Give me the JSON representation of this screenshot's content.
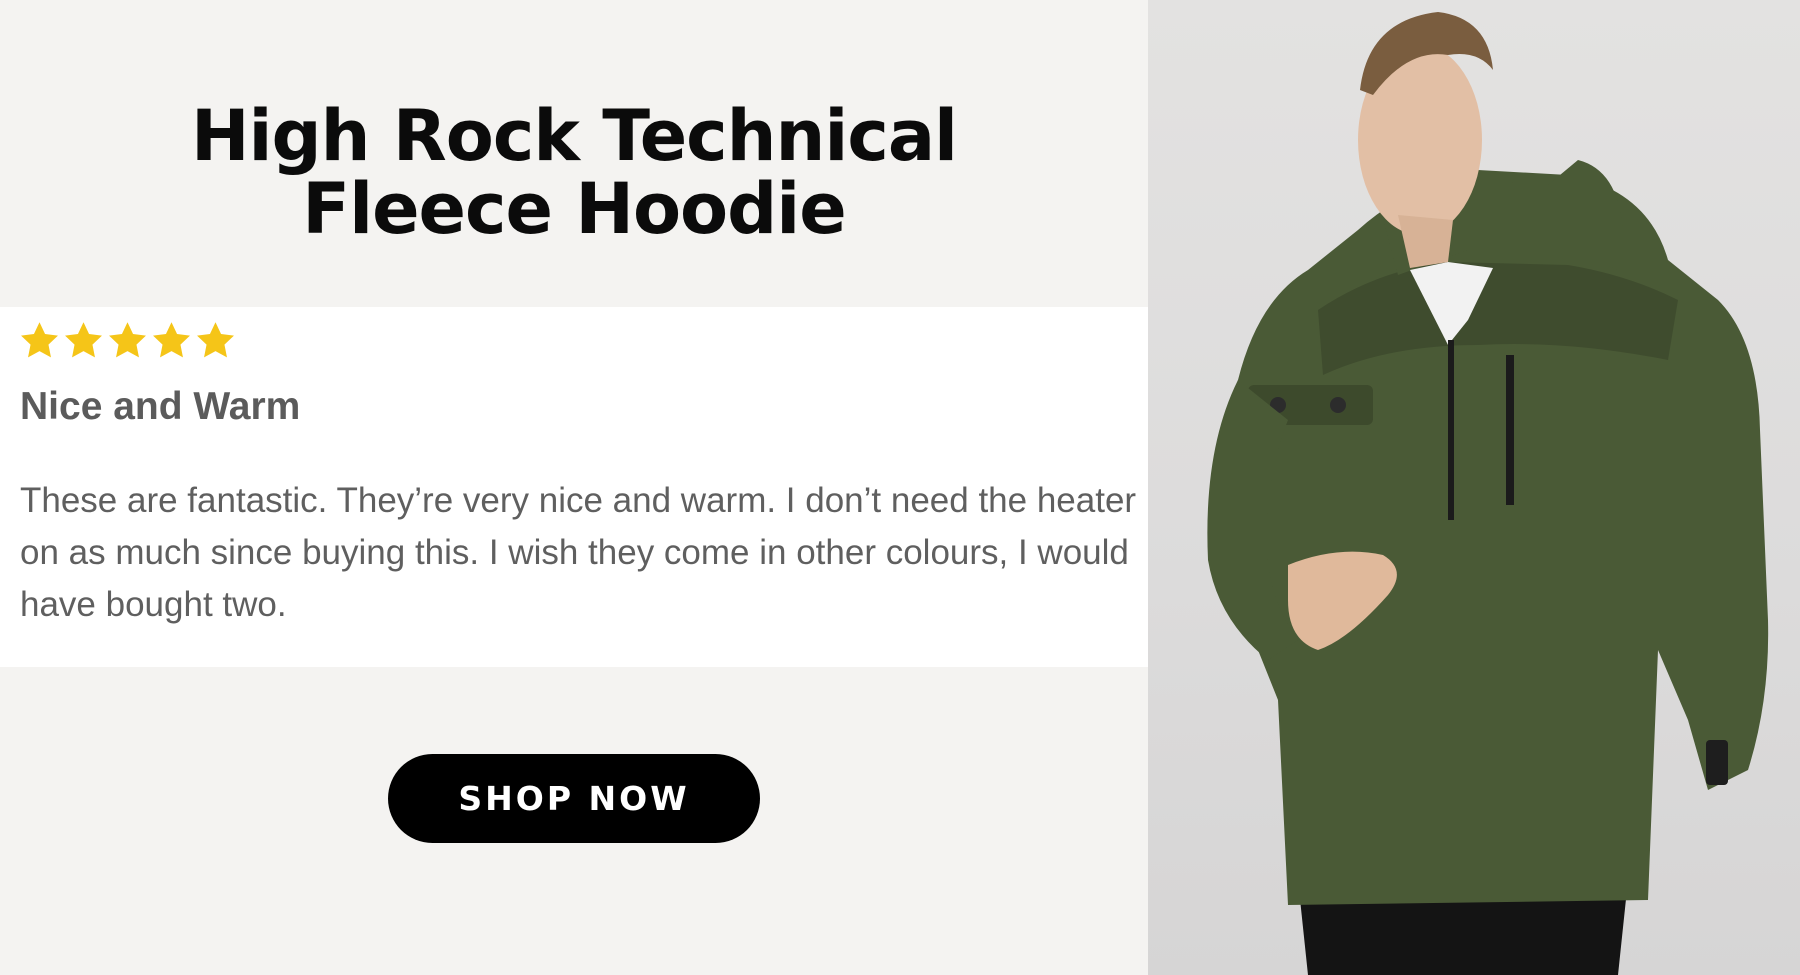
{
  "headline": {
    "line1": "High Rock Technical",
    "line2": "Fleece Hoodie"
  },
  "review": {
    "rating": 5,
    "rating_max": 5,
    "star_color": "#f5c518",
    "title": "Nice and Warm",
    "body": "These are fantastic. They’re very nice and warm. I don’t need the heater on as much since buying this. I wish they come in other colours, I would have bought two."
  },
  "cta": {
    "label": "SHOP NOW"
  },
  "product_image": {
    "subject": "model wearing olive green fleece hoodie",
    "fleece_color": "#4a5a36"
  }
}
